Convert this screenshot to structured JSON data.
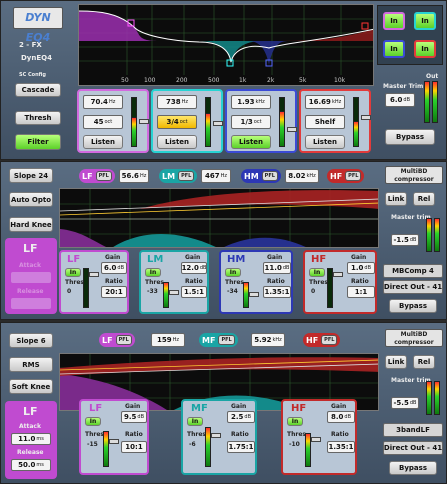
{
  "dyneq": {
    "logo": "DYN EQ4",
    "preset": "2 - FX",
    "name": "DynEQ4",
    "sc_config_label": "SC Config",
    "cascade": "Cascade",
    "thresh": "Thresh",
    "filter": "Filter",
    "freq_labels": [
      "50",
      "100",
      "200",
      "500",
      "1k",
      "2k",
      "5k",
      "10k"
    ],
    "in_buttons": [
      "In",
      "In",
      "In",
      "In"
    ],
    "master_trim_label": "Master Trim",
    "master_trim_value": "6.0",
    "master_trim_unit": "dB",
    "out_label": "Out",
    "bypass": "Bypass",
    "bands": [
      {
        "freq": "70.4",
        "freq_unit": "Hz",
        "width": "45",
        "width_unit": "oct",
        "listen": "Listen",
        "color": "#d26adf"
      },
      {
        "freq": "738",
        "freq_unit": "Hz",
        "width": "3/4",
        "width_unit": "oct",
        "listen": "Listen",
        "color": "#27d3d3"
      },
      {
        "freq": "1.93",
        "freq_unit": "kHz",
        "width": "1/3",
        "width_unit": "oct",
        "listen": "Listen",
        "color": "#3b4bd6"
      },
      {
        "freq": "16.69",
        "freq_unit": "kHz",
        "width": "Shelf",
        "width_unit": "",
        "listen": "Listen",
        "color": "#e23b3b"
      }
    ]
  },
  "mb4": {
    "slope": "Slope 24",
    "auto_opto": "Auto Opto",
    "hard_knee": "Hard Knee",
    "lf_label": "LF",
    "attack": "Attack",
    "release": "Release",
    "logo": "MultiBD compressor",
    "link": "Link",
    "rel": "Rel",
    "master_trim_label": "Master trim",
    "master_trim_value": "-1.5",
    "master_trim_unit": "dB",
    "preset": "MBComp 4",
    "direct_out": "Direct Out - 41",
    "bypass": "Bypass",
    "xover": [
      {
        "band": "LF",
        "pfl": "PFL",
        "freq": "56.6",
        "unit": "Hz",
        "color": "#c04bd0"
      },
      {
        "band": "LM",
        "pfl": "PFL",
        "freq": "467",
        "unit": "Hz",
        "color": "#1aa5a5"
      },
      {
        "band": "HM",
        "pfl": "PFL",
        "freq": "8.02",
        "unit": "kHz",
        "color": "#2d38b5"
      },
      {
        "band": "HF",
        "pfl": "PFL",
        "freq": "",
        "unit": "",
        "color": "#c22a2a"
      }
    ],
    "bands": [
      {
        "name": "LF",
        "in": "In",
        "gain_label": "Gain",
        "gain": "6.0",
        "gain_unit": "dB",
        "thres_label": "Thres",
        "thres": "0",
        "ratio_label": "Ratio",
        "ratio": "20:1",
        "color": "#c04bd0"
      },
      {
        "name": "LM",
        "in": "In",
        "gain_label": "Gain",
        "gain": "12.0",
        "gain_unit": "dB",
        "thres_label": "Thres",
        "thres": "-33",
        "ratio_label": "Ratio",
        "ratio": "1.5:1",
        "color": "#1aa5a5"
      },
      {
        "name": "HM",
        "in": "In",
        "gain_label": "Gain",
        "gain": "11.0",
        "gain_unit": "dB",
        "thres_label": "Thres",
        "thres": "-34",
        "ratio_label": "Ratio",
        "ratio": "1.35:1",
        "color": "#2d38b5"
      },
      {
        "name": "HF",
        "in": "In",
        "gain_label": "Gain",
        "gain": "1.0",
        "gain_unit": "dB",
        "thres_label": "Thres",
        "thres": "0",
        "ratio_label": "Ratio",
        "ratio": "1:1",
        "color": "#c22a2a"
      }
    ]
  },
  "mb3": {
    "slope": "Slope 6",
    "rms": "RMS",
    "soft_knee": "Soft Knee",
    "lf_label": "LF",
    "attack_label": "Attack",
    "attack": "11.0",
    "attack_unit": "ms",
    "release_label": "Release",
    "release": "50.0",
    "release_unit": "ms",
    "logo": "MultiBD compressor",
    "link": "Link",
    "rel": "Rel",
    "master_trim_label": "Master trim",
    "master_trim_value": "-5.5",
    "master_trim_unit": "dB",
    "preset": "3bandLF",
    "direct_out": "Direct Out - 41",
    "bypass": "Bypass",
    "xover": [
      {
        "band": "LF",
        "pfl": "PFL",
        "freq": "159",
        "unit": "Hz",
        "color": "#c04bd0"
      },
      {
        "band": "MF",
        "pfl": "PFL",
        "freq": "5.92",
        "unit": "kHz",
        "color": "#1aa5a5"
      },
      {
        "band": "HF",
        "pfl": "PFL",
        "freq": "",
        "unit": "",
        "color": "#c22a2a"
      }
    ],
    "bands": [
      {
        "name": "LF",
        "in": "In",
        "gain_label": "Gain",
        "gain": "9.5",
        "gain_unit": "dB",
        "thres_label": "Thres",
        "thres": "-15",
        "ratio_label": "Ratio",
        "ratio": "10:1",
        "color": "#c04bd0"
      },
      {
        "name": "MF",
        "in": "In",
        "gain_label": "Gain",
        "gain": "2.5",
        "gain_unit": "dB",
        "thres_label": "Thres",
        "thres": "-6",
        "ratio_label": "Ratio",
        "ratio": "1.75:1",
        "color": "#1aa5a5"
      },
      {
        "name": "HF",
        "in": "In",
        "gain_label": "Gain",
        "gain": "8.0",
        "gain_unit": "dB",
        "thres_label": "Thres",
        "thres": "-10",
        "ratio_label": "Ratio",
        "ratio": "1.35:1",
        "color": "#c22a2a"
      }
    ]
  }
}
